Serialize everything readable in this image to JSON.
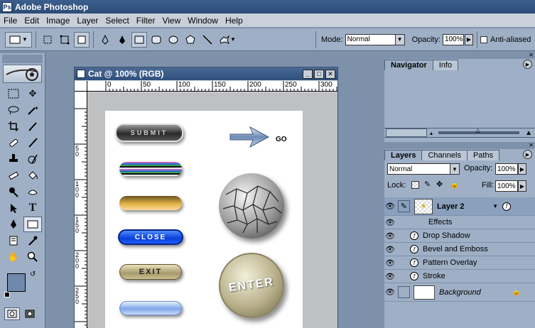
{
  "app": {
    "title": "Adobe Photoshop"
  },
  "menu": [
    "File",
    "Edit",
    "Image",
    "Layer",
    "Select",
    "Filter",
    "View",
    "Window",
    "Help"
  ],
  "options": {
    "mode_label": "Mode:",
    "mode_value": "Normal",
    "opacity_label": "Opacity:",
    "opacity_value": "100%",
    "antialias_label": "Anti-aliased"
  },
  "document": {
    "title": "Cat @ 100% (RGB)",
    "ruler_h": [
      "0",
      "50",
      "100",
      "150",
      "200",
      "250",
      "300"
    ],
    "ruler_v": [
      "50",
      "100",
      "150",
      "200",
      "250"
    ],
    "buttons": {
      "submit": "SUBMIT",
      "go": "GO",
      "close": "CLOSE",
      "exit": "EXIT",
      "enter": "ENTER"
    }
  },
  "navigator": {
    "tabs": [
      "Navigator",
      "Info"
    ]
  },
  "layers_panel": {
    "tabs": [
      "Layers",
      "Channels",
      "Paths"
    ],
    "blend_mode": "Normal",
    "opacity_label": "Opacity:",
    "opacity_value": "100%",
    "lock_label": "Lock:",
    "fill_label": "Fill:",
    "fill_value": "100%",
    "layers": [
      {
        "name": "Layer 2"
      },
      {
        "name": "Effects"
      },
      {
        "name": "Drop Shadow"
      },
      {
        "name": "Bevel and Emboss"
      },
      {
        "name": "Pattern Overlay"
      },
      {
        "name": "Stroke"
      },
      {
        "name": "Background"
      }
    ]
  },
  "colors": {
    "title_bar": "#2c4c77",
    "panel_bg": "#9fb0c6",
    "workspace": "#7d91ab",
    "foreground_swatch": "#6f89ad",
    "background_swatch": "#ffffff"
  }
}
